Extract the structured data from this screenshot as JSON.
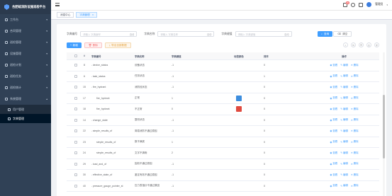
{
  "app": {
    "title": "合肥蛙消防设施巡检平台"
  },
  "sidebar": {
    "items": [
      {
        "label": "工作台"
      },
      {
        "label": "合同管理"
      },
      {
        "label": "巡检管理"
      },
      {
        "label": "设施管理"
      },
      {
        "label": "巡检计划"
      },
      {
        "label": "巡检任务"
      },
      {
        "label": "巡检统计"
      },
      {
        "label": "系统管理"
      }
    ],
    "sub_items": [
      {
        "label": "用户管理"
      },
      {
        "label": "字典管理"
      }
    ]
  },
  "header": {
    "badge": "99",
    "username": "管理员"
  },
  "tags": [
    {
      "label": "消息中心"
    },
    {
      "label": "字典管理"
    }
  ],
  "search": {
    "field1_label": "字典编号",
    "field1_placeholder": "请输入 字典编号",
    "field2_label": "字典名称",
    "field2_placeholder": "请输入 字典名称",
    "field3_label": "字典键值",
    "field3_placeholder": "请输入 字典键值",
    "suffix": "自动",
    "search_btn": "查询",
    "reset_btn": "清空"
  },
  "toolbar": {
    "add": "新增",
    "delete": "删除",
    "export": "导出全部数据"
  },
  "table": {
    "headers": [
      "#",
      "字典编号",
      "字典名称",
      "字典键值",
      "标签颜色",
      "排序",
      "操作"
    ],
    "ops": [
      "查看",
      "编辑",
      "删除"
    ],
    "rows": [
      {
        "id": "8",
        "code": "device_status",
        "name": "设备状态",
        "value": "-1",
        "color": "",
        "sort": "0",
        "expand": true,
        "indent": 0
      },
      {
        "id": "6",
        "code": "task_status",
        "name": "任务状态",
        "value": "-1",
        "color": "",
        "sort": "1",
        "expand": true,
        "indent": 0
      },
      {
        "id": "15",
        "code": "fire_hydrant",
        "name": "消防栓状态",
        "value": "-1",
        "color": "",
        "sort": "0",
        "expand": true,
        "indent": 0
      },
      {
        "id": "17",
        "code": "fire_hydrant",
        "name": "正常",
        "value": "1",
        "color": "#3c8dde",
        "sort": "0",
        "expand": false,
        "indent": 1
      },
      {
        "id": "18",
        "code": "fire_hydrant",
        "name": "不正常",
        "value": "0",
        "color": "#e04a3f",
        "sort": "0",
        "expand": false,
        "indent": 1
      },
      {
        "id": "14",
        "code": "change_state",
        "name": "整改状态",
        "value": "-1",
        "color": "",
        "sort": "0",
        "expand": true,
        "indent": 0
      },
      {
        "id": "22",
        "code": "simple_results_of",
        "name": "简易消防不通过原因",
        "value": "-1",
        "color": "",
        "sort": "0",
        "expand": true,
        "indent": 0
      },
      {
        "id": "23",
        "code": "simple_results_of",
        "name": "数不满类",
        "value": "1",
        "color": "",
        "sort": "0",
        "expand": false,
        "indent": 1
      },
      {
        "id": "24",
        "code": "simple_results_of",
        "name": "文字不清晰",
        "value": "2",
        "color": "",
        "sort": "0",
        "expand": false,
        "indent": 1
      },
      {
        "id": "29",
        "code": "load_and_of",
        "name": "因改不通过原因",
        "value": "-1",
        "color": "",
        "sort": "0",
        "expand": true,
        "indent": 0
      },
      {
        "id": "30",
        "code": "effective_state_of",
        "name": "鉴定有效不通过原因",
        "value": "-1",
        "color": "",
        "sort": "0",
        "expand": true,
        "indent": 0
      },
      {
        "id": "40",
        "code": "pressure_gauge_pointer_st",
        "name": "压力表指针不通过原因",
        "value": "-1",
        "color": "",
        "sort": "0",
        "expand": true,
        "indent": 0
      }
    ]
  },
  "colors": {
    "primary": "#409eff",
    "sidebar": "#304156"
  }
}
